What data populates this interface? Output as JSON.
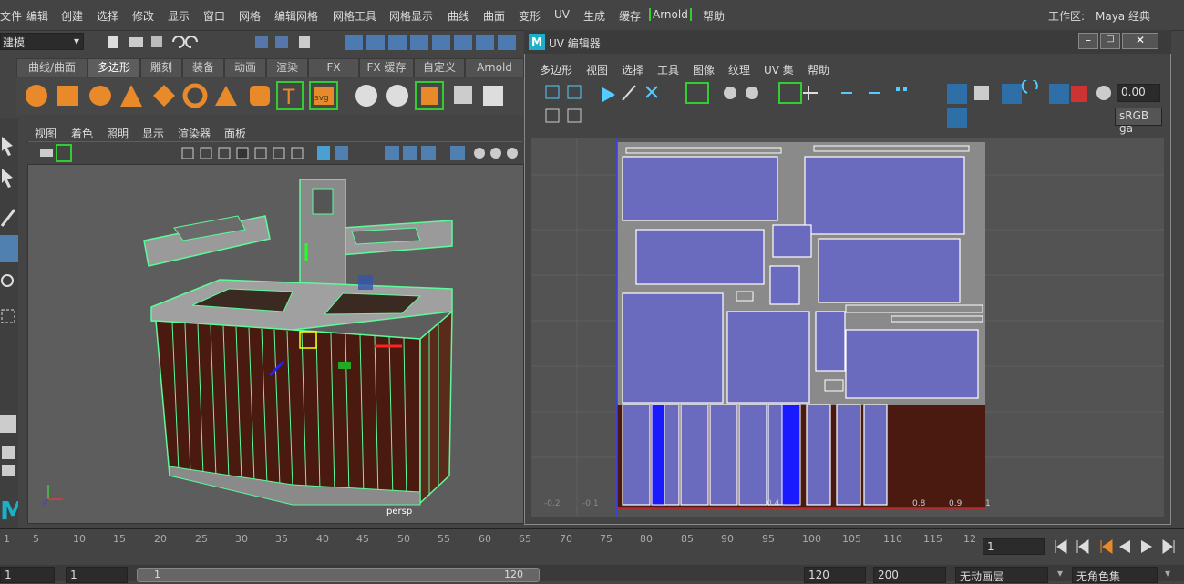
{
  "menubar": {
    "items": [
      "文件",
      "编辑",
      "创建",
      "选择",
      "修改",
      "显示",
      "窗口",
      "网格",
      "编辑网格",
      "网格工具",
      "网格显示",
      "曲线",
      "曲面",
      "变形",
      "UV",
      "生成",
      "缓存",
      "Arnold",
      "帮助"
    ],
    "workspace_label": "工作区:",
    "workspace_value": "Maya 经典"
  },
  "mode_selector": "建模",
  "shelf_tabs": [
    "曲线/曲面",
    "多边形",
    "雕刻",
    "装备",
    "动画",
    "渲染",
    "FX",
    "FX 缓存",
    "自定义",
    "Arnold"
  ],
  "shelf_active": "多边形",
  "viewport": {
    "menu": [
      "视图",
      "着色",
      "照明",
      "显示",
      "渲染器",
      "面板"
    ],
    "camera_label": "persp"
  },
  "uv_editor": {
    "title": "UV 编辑器",
    "logo": "M",
    "menu": [
      "多边形",
      "视图",
      "选择",
      "工具",
      "图像",
      "纹理",
      "UV 集",
      "帮助"
    ],
    "value_field": "0.00",
    "color_space": "sRGB ga",
    "axis_labels": [
      "-0.2",
      "-0.1",
      "0.4",
      "0.8",
      "0.9",
      "1"
    ]
  },
  "timeline": {
    "ticks": [
      "1",
      "5",
      "10",
      "15",
      "20",
      "25",
      "30",
      "35",
      "40",
      "45",
      "50",
      "55",
      "60",
      "65",
      "70",
      "75",
      "80",
      "85",
      "90",
      "95",
      "100",
      "105",
      "110",
      "115",
      "12"
    ],
    "current_frame": "1"
  },
  "range": {
    "start": "1",
    "anim_start": "1",
    "range_start": "1",
    "range_end": "120",
    "anim_end": "120",
    "end": "200",
    "anim_layer": "无动画层",
    "char_set": "无角色集"
  },
  "colors": {
    "accent_green": "#33cc33",
    "uv_blue": "#6a6abf",
    "wood": "#4a1a10"
  }
}
